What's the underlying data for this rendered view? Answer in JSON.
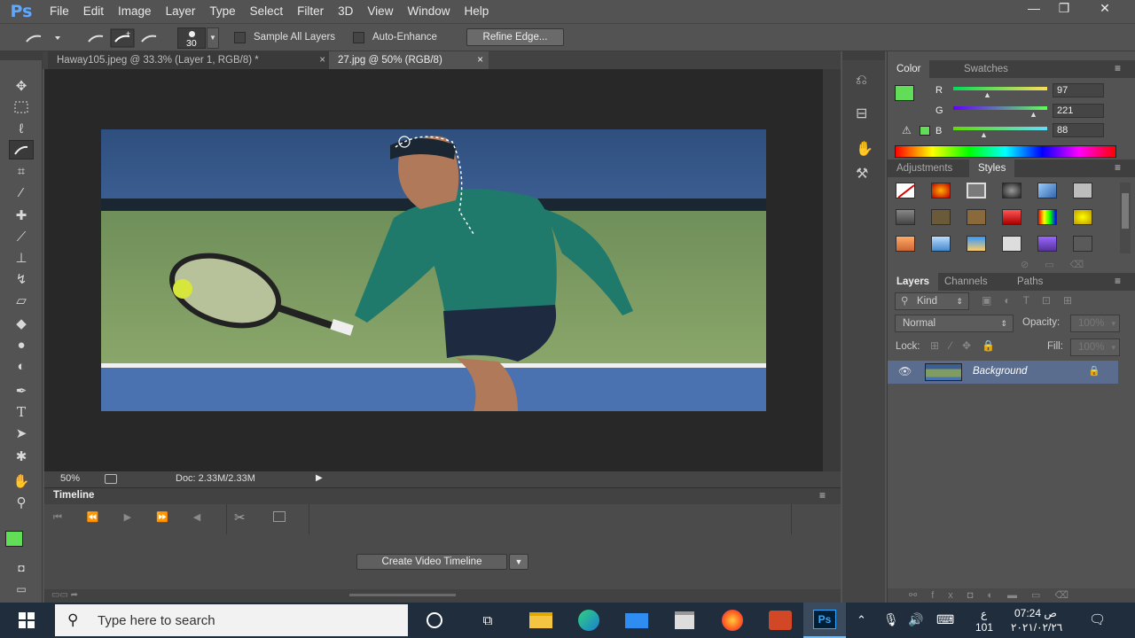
{
  "app": {
    "logo": "Ps"
  },
  "menu": [
    "File",
    "Edit",
    "Image",
    "Layer",
    "Type",
    "Select",
    "Filter",
    "3D",
    "View",
    "Window",
    "Help"
  ],
  "window_controls": {
    "minimize": "—",
    "restore": "❐",
    "close": "✕"
  },
  "options": {
    "brush_size": "30",
    "sample_all_layers": "Sample All Layers",
    "auto_enhance": "Auto-Enhance",
    "refine_edge": "Refine Edge..."
  },
  "doc_tabs": [
    {
      "label": "Haway105.jpeg @ 33.3% (Layer 1, RGB/8) *",
      "close": "×",
      "active": false
    },
    {
      "label": "27.jpg @ 50% (RGB/8)",
      "close": "×",
      "active": true
    }
  ],
  "status": {
    "zoom": "50%",
    "doc": "Doc: 2.33M/2.33M"
  },
  "timeline": {
    "title": "Timeline",
    "create_button": "Create Video Timeline"
  },
  "color_panel": {
    "tabs": [
      "Color",
      "Swatches"
    ],
    "foreground": "#61dd58",
    "channels": [
      {
        "label": "R",
        "value": "97"
      },
      {
        "label": "G",
        "value": "221"
      },
      {
        "label": "B",
        "value": "88"
      }
    ]
  },
  "styles_panel": {
    "tabs": [
      "Adjustments",
      "Styles"
    ]
  },
  "layers_panel": {
    "tabs": [
      "Layers",
      "Channels",
      "Paths"
    ],
    "kind": "Kind",
    "blend_mode": "Normal",
    "opacity_label": "Opacity:",
    "opacity_value": "100%",
    "lock_label": "Lock:",
    "fill_label": "Fill:",
    "fill_value": "100%",
    "layers": [
      {
        "name": "Background",
        "visible": true,
        "locked": true
      }
    ]
  },
  "taskbar": {
    "search_placeholder": "Type here to search",
    "clock_time": "07:24 ص",
    "clock_date": "٢٠٢١/٠٢/٢٦",
    "lang": "ع",
    "lang_sub": "101",
    "ps_label": "Ps"
  },
  "accent": "#3d97e8"
}
